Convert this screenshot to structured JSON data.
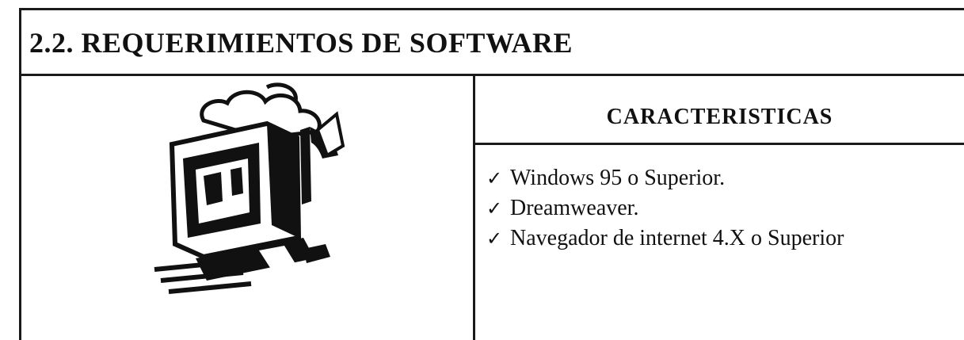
{
  "section": {
    "title": "2.2.  REQUERIMIENTOS DE SOFTWARE"
  },
  "characteristics": {
    "header": "CARACTERISTICAS",
    "items": [
      "Windows 95  o  Superior.",
      "Dreamweaver.",
      "Navegador de internet 4.X  o Superior"
    ]
  },
  "clipart": {
    "icon": "computer-clipart-icon",
    "color": "#111111"
  }
}
